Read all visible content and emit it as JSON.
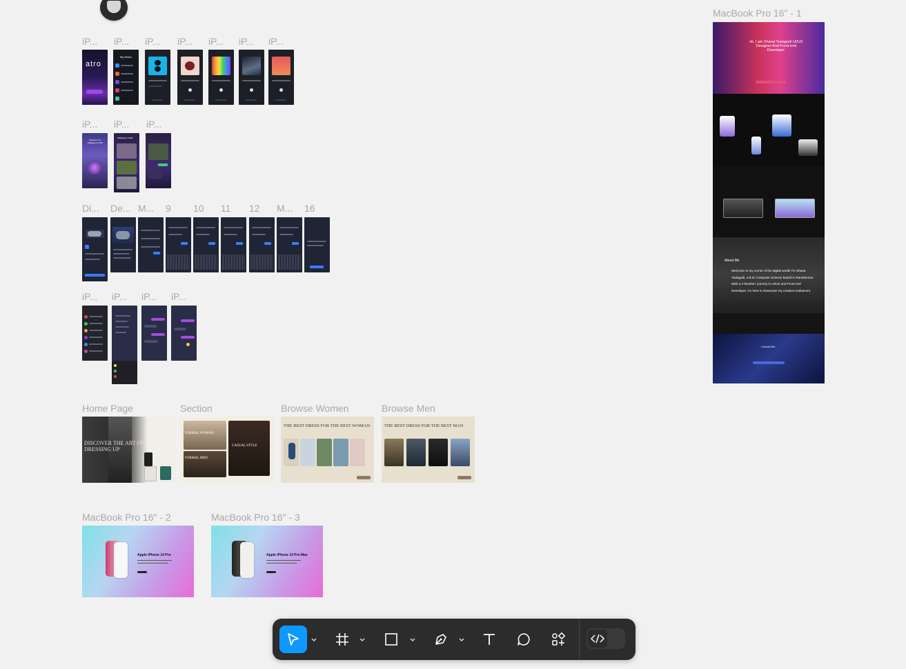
{
  "canvas": {
    "frame_labels": {
      "row1": [
        "iP...",
        "iP...",
        "iP...",
        "iP...",
        "iP...",
        "iP...",
        "iP..."
      ],
      "row2": [
        "iP...",
        "iP...",
        "iP..."
      ],
      "row3": [
        "Di...",
        "De...",
        "M...",
        "9",
        "10",
        "11",
        "12",
        "M...",
        "16"
      ],
      "row4": [
        "iP...",
        "iP...",
        "iP...",
        "iP..."
      ],
      "row5": [
        "Home Page",
        "Section",
        "Browse Women",
        "Browse Men"
      ],
      "row6": [
        "MacBook Pro 16\" - 2",
        "MacBook Pro 16\" - 3"
      ],
      "macbook1": "MacBook Pro 16\" - 1"
    },
    "frame_text": {
      "atro_logo": "atro",
      "my_music": "My Music",
      "wallpapers_welcome": "Welcome To Wallpapers HUB",
      "wallpapers_title": "Wallpapers HUB",
      "home_hero": "DISCOVER THE ART OF DRESSING UP",
      "section_formal_women": "FORMAL WOMAN",
      "section_casual": "CASUAL STYLE",
      "section_formal_men": "FORMAL MEN",
      "women_title": "THE BEST DRESS FOR THE BEST WOMAN",
      "men_title": "THE BEST DRESS FOR THE BEST MAN",
      "iphone_pro": "Apple iPhone 14 Pro",
      "iphone_pro_max": "Apple iPhone 14 Pro Max",
      "portfolio_hero": "Hi, I am Sharat Yadagodi UI/UX Designer And Front-end Developer.",
      "about_title": "About Me",
      "about_body": "Welcome to my corner of the digital world! I'm Sharat Yadagodi, a B.sc Computer Science based in Ranebennur. With a 3 Months+ journey in UI/UX and Front-end Developer, I'm here to showcase my creative endeavors.",
      "contact_title": "Contact Me"
    }
  },
  "toolbar": {
    "tools": [
      {
        "name": "move",
        "icon": "cursor-icon",
        "active": true
      },
      {
        "name": "frame",
        "icon": "frame-icon"
      },
      {
        "name": "shape",
        "icon": "rectangle-icon"
      },
      {
        "name": "pen",
        "icon": "pen-icon"
      },
      {
        "name": "text",
        "icon": "text-icon"
      },
      {
        "name": "comment",
        "icon": "comment-icon"
      },
      {
        "name": "actions",
        "icon": "components-icon"
      },
      {
        "name": "dev-mode",
        "icon": "code-icon"
      }
    ],
    "colors": {
      "bar": "#2c2c2c",
      "active": "#0d99ff"
    }
  }
}
